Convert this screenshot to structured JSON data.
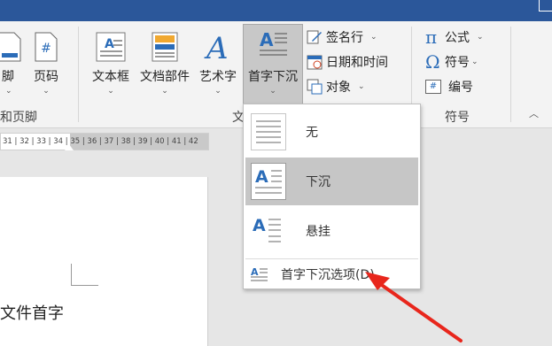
{
  "ribbon": {
    "group_header_footer": {
      "footer_label": "脚",
      "page_number_label": "页码",
      "group_label": "和页脚"
    },
    "group_text": {
      "textbox_label": "文本框",
      "quickparts_label": "文档部件",
      "wordart_label": "艺术字",
      "dropcap_label": "首字下沉",
      "signature_label": "签名行",
      "datetime_label": "日期和时间",
      "object_label": "对象",
      "group_label": "文"
    },
    "group_symbols": {
      "equation_label": "公式",
      "symbol_label": "符号",
      "number_label": "编号",
      "group_label": "符号",
      "equation_glyph": "π",
      "symbol_glyph": "Ω",
      "number_glyph": "#"
    }
  },
  "ruler": {
    "text": "31 | 32 | 33 | 34 | 35 | 36 | 37 | 38 | 39 | 40 | 41 | 42"
  },
  "document": {
    "text": "文件首字"
  },
  "dropcap_menu": {
    "items": [
      {
        "label": "无"
      },
      {
        "label": "下沉"
      },
      {
        "label": "悬挂"
      }
    ],
    "options_label": "首字下沉选项(D)...",
    "selected_index": 1
  },
  "colors": {
    "titlebar": "#2b579a",
    "accent_icon": "#2b6cb8",
    "annotation_arrow": "#e8261c"
  }
}
